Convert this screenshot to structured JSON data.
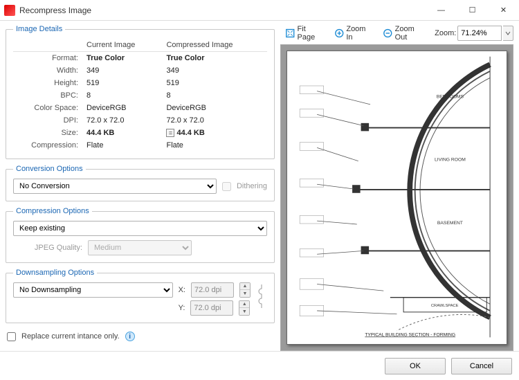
{
  "window": {
    "title": "Recompress Image",
    "minimize": "—",
    "maximize": "☐",
    "close": "✕"
  },
  "details": {
    "legend": "Image Details",
    "col_current": "Current Image",
    "col_compressed": "Compressed Image",
    "rows": [
      {
        "label": "Format:",
        "current": "True Color",
        "compressed": "True Color",
        "bold": true
      },
      {
        "label": "Width:",
        "current": "349",
        "compressed": "349"
      },
      {
        "label": "Height:",
        "current": "519",
        "compressed": "519"
      },
      {
        "label": "BPC:",
        "current": "8",
        "compressed": "8"
      },
      {
        "label": "Color Space:",
        "current": "DeviceRGB",
        "compressed": "DeviceRGB"
      },
      {
        "label": "DPI:",
        "current": "72.0 x 72.0",
        "compressed": "72.0 x 72.0"
      },
      {
        "label": "Size:",
        "current": "44.4 KB",
        "compressed": "44.4 KB",
        "equal_icon": true,
        "bold": true
      },
      {
        "label": "Compression:",
        "current": "Flate",
        "compressed": "Flate"
      }
    ]
  },
  "conversion": {
    "legend": "Conversion Options",
    "value": "No Conversion",
    "dither_label": "Dithering"
  },
  "compression": {
    "legend": "Compression Options",
    "value": "Keep existing",
    "jpeg_quality_label": "JPEG Quality:",
    "jpeg_quality_value": "Medium"
  },
  "downsampling": {
    "legend": "Downsampling Options",
    "value": "No Downsampling",
    "x_label": "X:",
    "x_value": "72.0 dpi",
    "y_label": "Y:",
    "y_value": "72.0 dpi"
  },
  "replace_label": "Replace current intance only.",
  "toolbar": {
    "fit": "Fit Page",
    "zoom_in": "Zoom In",
    "zoom_out": "Zoom Out",
    "zoom_label": "Zoom:",
    "zoom_value": "71.24%"
  },
  "preview": {
    "caption": "TYPICAL BUILDING SECTION - FORMING",
    "rooms": [
      "BEDROOMS",
      "LIVING ROOM",
      "BASEMENT",
      "CRAWLSPACE"
    ]
  },
  "footer": {
    "ok": "OK",
    "cancel": "Cancel"
  }
}
